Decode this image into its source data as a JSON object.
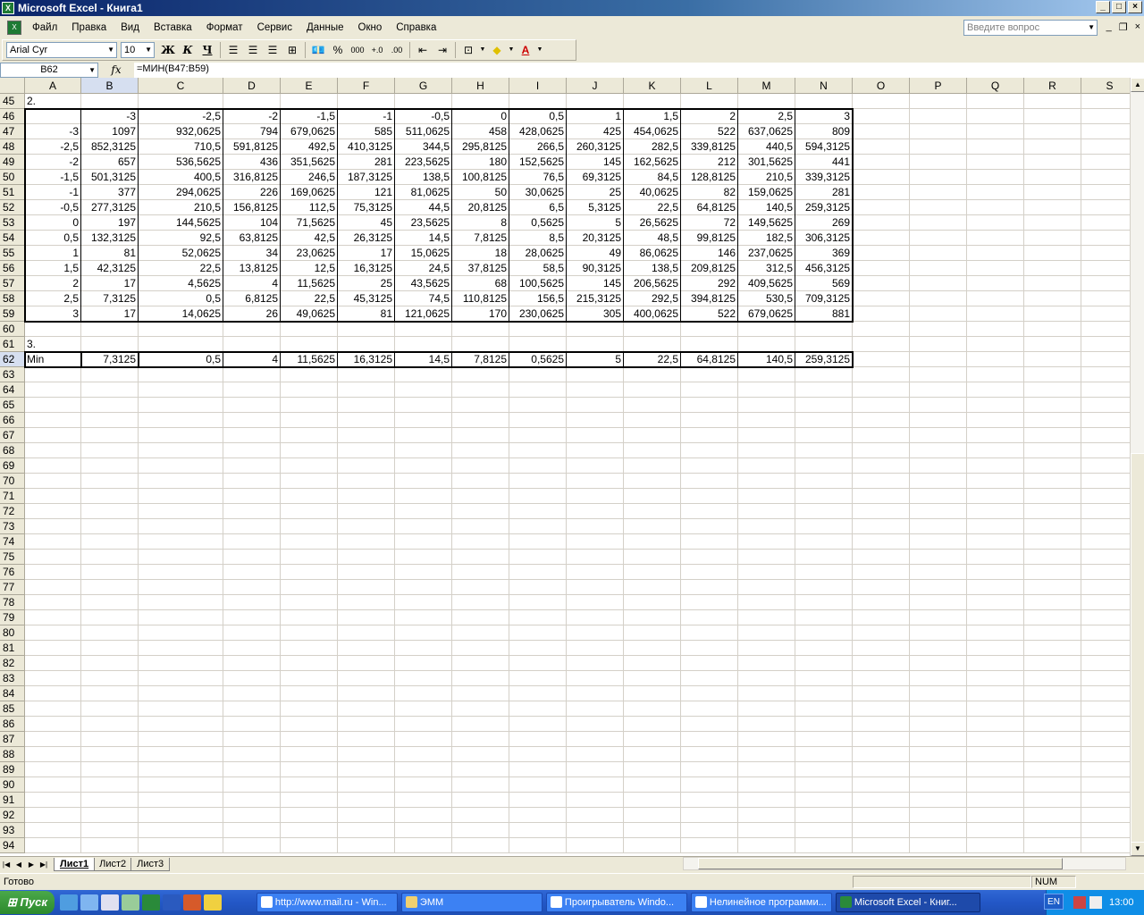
{
  "window": {
    "title": "Microsoft Excel - Книга1"
  },
  "menu": [
    "Файл",
    "Правка",
    "Вид",
    "Вставка",
    "Формат",
    "Сервис",
    "Данные",
    "Окно",
    "Справка"
  ],
  "ask_placeholder": "Введите вопрос",
  "toolbar": {
    "font": "Arial Cyr",
    "size": "10",
    "bold": "Ж",
    "italic": "К",
    "underline": "Ч",
    "percent": "%",
    "thousands": "000"
  },
  "namebox": "B62",
  "fx": "fx",
  "formula": "=МИН(B47:B59)",
  "columns": [
    {
      "name": "A",
      "w": 63
    },
    {
      "name": "B",
      "w": 64
    },
    {
      "name": "C",
      "w": 95
    },
    {
      "name": "D",
      "w": 64
    },
    {
      "name": "E",
      "w": 64
    },
    {
      "name": "F",
      "w": 64
    },
    {
      "name": "G",
      "w": 64
    },
    {
      "name": "H",
      "w": 64
    },
    {
      "name": "I",
      "w": 64
    },
    {
      "name": "J",
      "w": 64
    },
    {
      "name": "K",
      "w": 64
    },
    {
      "name": "L",
      "w": 64
    },
    {
      "name": "M",
      "w": 64
    },
    {
      "name": "N",
      "w": 64
    },
    {
      "name": "O",
      "w": 64
    },
    {
      "name": "P",
      "w": 64
    },
    {
      "name": "Q",
      "w": 64
    },
    {
      "name": "R",
      "w": 64
    },
    {
      "name": "S",
      "w": 64
    }
  ],
  "first_row": 45,
  "row_count": 50,
  "selected_cell": "B62",
  "rows": {
    "45": {
      "A": "2."
    },
    "46": {
      "B": "-3",
      "C": "-2,5",
      "D": "-2",
      "E": "-1,5",
      "F": "-1",
      "G": "-0,5",
      "H": "0",
      "I": "0,5",
      "J": "1",
      "K": "1,5",
      "L": "2",
      "M": "2,5",
      "N": "3"
    },
    "47": {
      "A": "-3",
      "B": "1097",
      "C": "932,0625",
      "D": "794",
      "E": "679,0625",
      "F": "585",
      "G": "511,0625",
      "H": "458",
      "I": "428,0625",
      "J": "425",
      "K": "454,0625",
      "L": "522",
      "M": "637,0625",
      "N": "809"
    },
    "48": {
      "A": "-2,5",
      "B": "852,3125",
      "C": "710,5",
      "D": "591,8125",
      "E": "492,5",
      "F": "410,3125",
      "G": "344,5",
      "H": "295,8125",
      "I": "266,5",
      "J": "260,3125",
      "K": "282,5",
      "L": "339,8125",
      "M": "440,5",
      "N": "594,3125"
    },
    "49": {
      "A": "-2",
      "B": "657",
      "C": "536,5625",
      "D": "436",
      "E": "351,5625",
      "F": "281",
      "G": "223,5625",
      "H": "180",
      "I": "152,5625",
      "J": "145",
      "K": "162,5625",
      "L": "212",
      "M": "301,5625",
      "N": "441"
    },
    "50": {
      "A": "-1,5",
      "B": "501,3125",
      "C": "400,5",
      "D": "316,8125",
      "E": "246,5",
      "F": "187,3125",
      "G": "138,5",
      "H": "100,8125",
      "I": "76,5",
      "J": "69,3125",
      "K": "84,5",
      "L": "128,8125",
      "M": "210,5",
      "N": "339,3125"
    },
    "51": {
      "A": "-1",
      "B": "377",
      "C": "294,0625",
      "D": "226",
      "E": "169,0625",
      "F": "121",
      "G": "81,0625",
      "H": "50",
      "I": "30,0625",
      "J": "25",
      "K": "40,0625",
      "L": "82",
      "M": "159,0625",
      "N": "281"
    },
    "52": {
      "A": "-0,5",
      "B": "277,3125",
      "C": "210,5",
      "D": "156,8125",
      "E": "112,5",
      "F": "75,3125",
      "G": "44,5",
      "H": "20,8125",
      "I": "6,5",
      "J": "5,3125",
      "K": "22,5",
      "L": "64,8125",
      "M": "140,5",
      "N": "259,3125"
    },
    "53": {
      "A": "0",
      "B": "197",
      "C": "144,5625",
      "D": "104",
      "E": "71,5625",
      "F": "45",
      "G": "23,5625",
      "H": "8",
      "I": "0,5625",
      "J": "5",
      "K": "26,5625",
      "L": "72",
      "M": "149,5625",
      "N": "269"
    },
    "54": {
      "A": "0,5",
      "B": "132,3125",
      "C": "92,5",
      "D": "63,8125",
      "E": "42,5",
      "F": "26,3125",
      "G": "14,5",
      "H": "7,8125",
      "I": "8,5",
      "J": "20,3125",
      "K": "48,5",
      "L": "99,8125",
      "M": "182,5",
      "N": "306,3125"
    },
    "55": {
      "A": "1",
      "B": "81",
      "C": "52,0625",
      "D": "34",
      "E": "23,0625",
      "F": "17",
      "G": "15,0625",
      "H": "18",
      "I": "28,0625",
      "J": "49",
      "K": "86,0625",
      "L": "146",
      "M": "237,0625",
      "N": "369"
    },
    "56": {
      "A": "1,5",
      "B": "42,3125",
      "C": "22,5",
      "D": "13,8125",
      "E": "12,5",
      "F": "16,3125",
      "G": "24,5",
      "H": "37,8125",
      "I": "58,5",
      "J": "90,3125",
      "K": "138,5",
      "L": "209,8125",
      "M": "312,5",
      "N": "456,3125"
    },
    "57": {
      "A": "2",
      "B": "17",
      "C": "4,5625",
      "D": "4",
      "E": "11,5625",
      "F": "25",
      "G": "43,5625",
      "H": "68",
      "I": "100,5625",
      "J": "145",
      "K": "206,5625",
      "L": "292",
      "M": "409,5625",
      "N": "569"
    },
    "58": {
      "A": "2,5",
      "B": "7,3125",
      "C": "0,5",
      "D": "6,8125",
      "E": "22,5",
      "F": "45,3125",
      "G": "74,5",
      "H": "110,8125",
      "I": "156,5",
      "J": "215,3125",
      "K": "292,5",
      "L": "394,8125",
      "M": "530,5",
      "N": "709,3125"
    },
    "59": {
      "A": "3",
      "B": "17",
      "C": "14,0625",
      "D": "26",
      "E": "49,0625",
      "F": "81",
      "G": "121,0625",
      "H": "170",
      "I": "230,0625",
      "J": "305",
      "K": "400,0625",
      "L": "522",
      "M": "679,0625",
      "N": "881"
    },
    "61": {
      "A": "3."
    },
    "62": {
      "A": "Min",
      "B": "7,3125",
      "C": "0,5",
      "D": "4",
      "E": "11,5625",
      "F": "16,3125",
      "G": "14,5",
      "H": "7,8125",
      "I": "0,5625",
      "J": "5",
      "K": "22,5",
      "L": "64,8125",
      "M": "140,5",
      "N": "259,3125"
    }
  },
  "text_cells": [
    "45A",
    "61A",
    "62A"
  ],
  "sheets": [
    "Лист1",
    "Лист2",
    "Лист3"
  ],
  "status": {
    "ready": "Готово",
    "num": "NUM"
  },
  "taskbar": {
    "start": "Пуск",
    "tasks": [
      "http://www.mail.ru - Win...",
      "ЭММ",
      "Проигрыватель Windo...",
      "Нелинейное программи...",
      "Microsoft Excel - Книг..."
    ],
    "lang": "EN",
    "clock": "13:00"
  }
}
